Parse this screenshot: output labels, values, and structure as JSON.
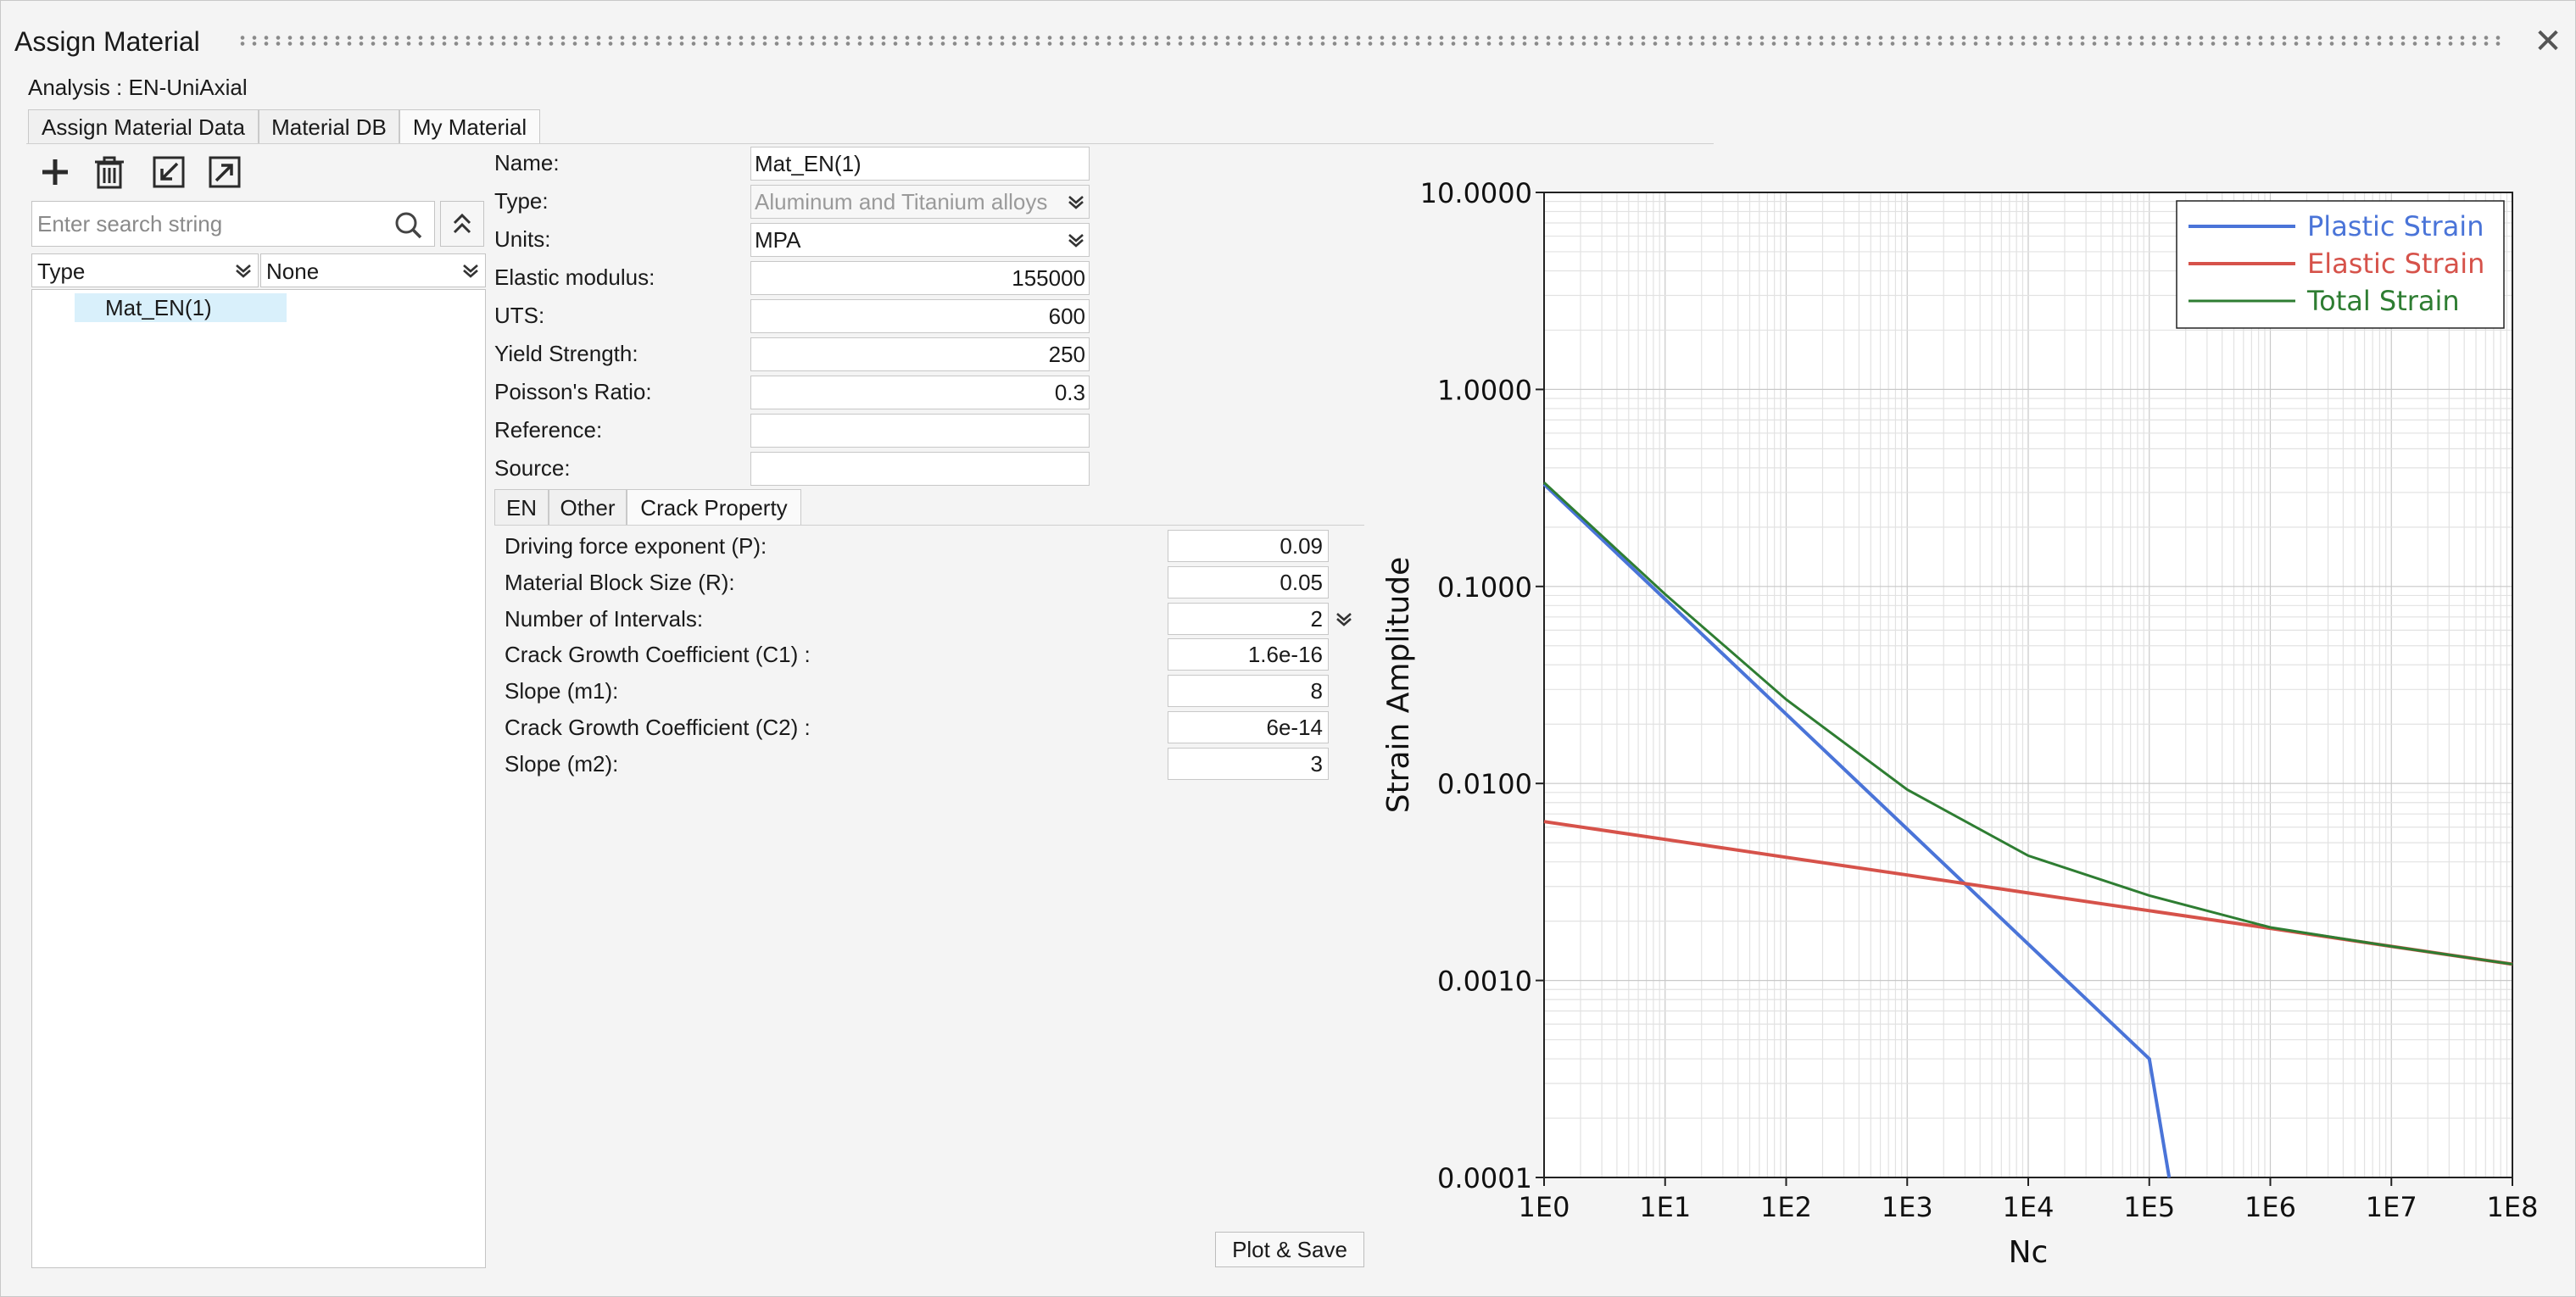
{
  "window": {
    "title": "Assign Material",
    "close_icon": "close-icon"
  },
  "analysis_label": "Analysis : EN-UniAxial",
  "tabs": [
    {
      "label": "Assign Material Data",
      "active": false
    },
    {
      "label": "Material DB",
      "active": false
    },
    {
      "label": "My Material",
      "active": true
    }
  ],
  "toolbar": {
    "icons": [
      "add-icon",
      "delete-icon",
      "import-icon",
      "export-icon"
    ]
  },
  "search": {
    "placeholder": "Enter search string",
    "value": ""
  },
  "filters": {
    "type_label": "Type",
    "none_label": "None"
  },
  "tree": {
    "items": [
      "Mat_EN(1)"
    ]
  },
  "form": {
    "name_label": "Name:",
    "name_value": "Mat_EN(1)",
    "type_label": "Type:",
    "type_value": "Aluminum and Titanium alloys",
    "units_label": "Units:",
    "units_value": "MPA",
    "elastic_label": "Elastic modulus:",
    "elastic_value": "155000",
    "uts_label": "UTS:",
    "uts_value": "600",
    "yield_label": "Yield Strength:",
    "yield_value": "250",
    "poisson_label": "Poisson's Ratio:",
    "poisson_value": "0.3",
    "reference_label": "Reference:",
    "reference_value": "",
    "source_label": "Source:",
    "source_value": ""
  },
  "subtabs": [
    {
      "label": "EN",
      "active": false
    },
    {
      "label": "Other",
      "active": false
    },
    {
      "label": "Crack Property",
      "active": true
    }
  ],
  "crack": {
    "p_label": "Driving force exponent (P):",
    "p_value": "0.09",
    "r_label": "Material Block Size (R):",
    "r_value": "0.05",
    "n_label": "Number of Intervals:",
    "n_value": "2",
    "c1_label": "Crack Growth Coefficient (C1) :",
    "c1_value": "1.6e-16",
    "m1_label": "Slope (m1):",
    "m1_value": "8",
    "c2_label": "Crack Growth Coefficient (C2) :",
    "c2_value": "6e-14",
    "m2_label": "Slope (m2):",
    "m2_value": "3"
  },
  "plot_button": "Plot & Save",
  "chart_data": {
    "type": "line",
    "xscale": "log",
    "yscale": "log",
    "xlabel": "Nc",
    "ylabel": "Strain Amplitude",
    "xlim": [
      1,
      100000000
    ],
    "ylim": [
      0.0001,
      10
    ],
    "xticks": [
      "1E0",
      "1E1",
      "1E2",
      "1E3",
      "1E4",
      "1E5",
      "1E6",
      "1E7",
      "1E8"
    ],
    "yticks": [
      "10.0000",
      "1.0000",
      "0.1000",
      "0.0100",
      "0.0010",
      "0.0001"
    ],
    "grid": true,
    "legend_position": "top-right",
    "series": [
      {
        "name": "Plastic Strain",
        "color": "#4a74d8",
        "x": [
          1,
          10,
          100,
          1000,
          10000,
          100000,
          146000
        ],
        "y": [
          0.33,
          0.0861,
          0.0225,
          0.00587,
          0.00153,
          0.0004,
          0.0001
        ]
      },
      {
        "name": "Elastic Strain",
        "color": "#d6524a",
        "x": [
          1,
          10,
          100,
          1000,
          10000,
          100000,
          1000000,
          10000000,
          100000000
        ],
        "y": [
          0.0064,
          0.0052,
          0.00422,
          0.00343,
          0.00278,
          0.00226,
          0.00184,
          0.00149,
          0.00121
        ]
      },
      {
        "name": "Total Strain",
        "color": "#2e7d32",
        "x": [
          1,
          10,
          100,
          1000,
          10000,
          100000,
          1000000,
          10000000,
          100000000
        ],
        "y": [
          0.337,
          0.0913,
          0.0267,
          0.0093,
          0.0043,
          0.0027,
          0.00186,
          0.00149,
          0.00121
        ]
      }
    ]
  }
}
